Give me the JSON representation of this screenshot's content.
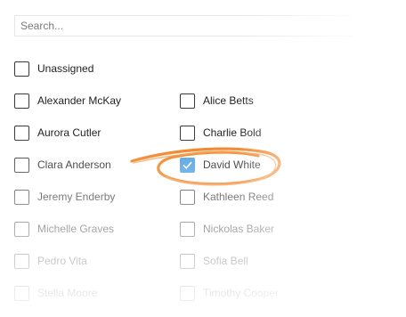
{
  "search": {
    "placeholder": "Search..."
  },
  "options": {
    "unassigned": {
      "label": "Unassigned",
      "checked": false
    },
    "left": [
      {
        "label": "Alexander McKay",
        "checked": false
      },
      {
        "label": "Aurora Cutler",
        "checked": false
      },
      {
        "label": "Clara Anderson",
        "checked": false
      },
      {
        "label": "Jeremy Enderby",
        "checked": false
      },
      {
        "label": "Michelle Graves",
        "checked": false
      },
      {
        "label": "Pedro Vita",
        "checked": false
      },
      {
        "label": "Stella Moore",
        "checked": false
      }
    ],
    "right": [
      {
        "label": "Alice Betts",
        "checked": false
      },
      {
        "label": "Charlie Bold",
        "checked": false
      },
      {
        "label": "David White",
        "checked": true
      },
      {
        "label": "Kathleen Reed",
        "checked": false
      },
      {
        "label": "Nickolas Baker",
        "checked": false
      },
      {
        "label": "Sofia Bell",
        "checked": false
      },
      {
        "label": "Timothy Cooper",
        "checked": false
      }
    ]
  },
  "colors": {
    "checkbox_checked": "#4a9de0",
    "highlight_scribble": "#f07d1a"
  },
  "icons": {
    "checked_mark": "check-icon"
  }
}
